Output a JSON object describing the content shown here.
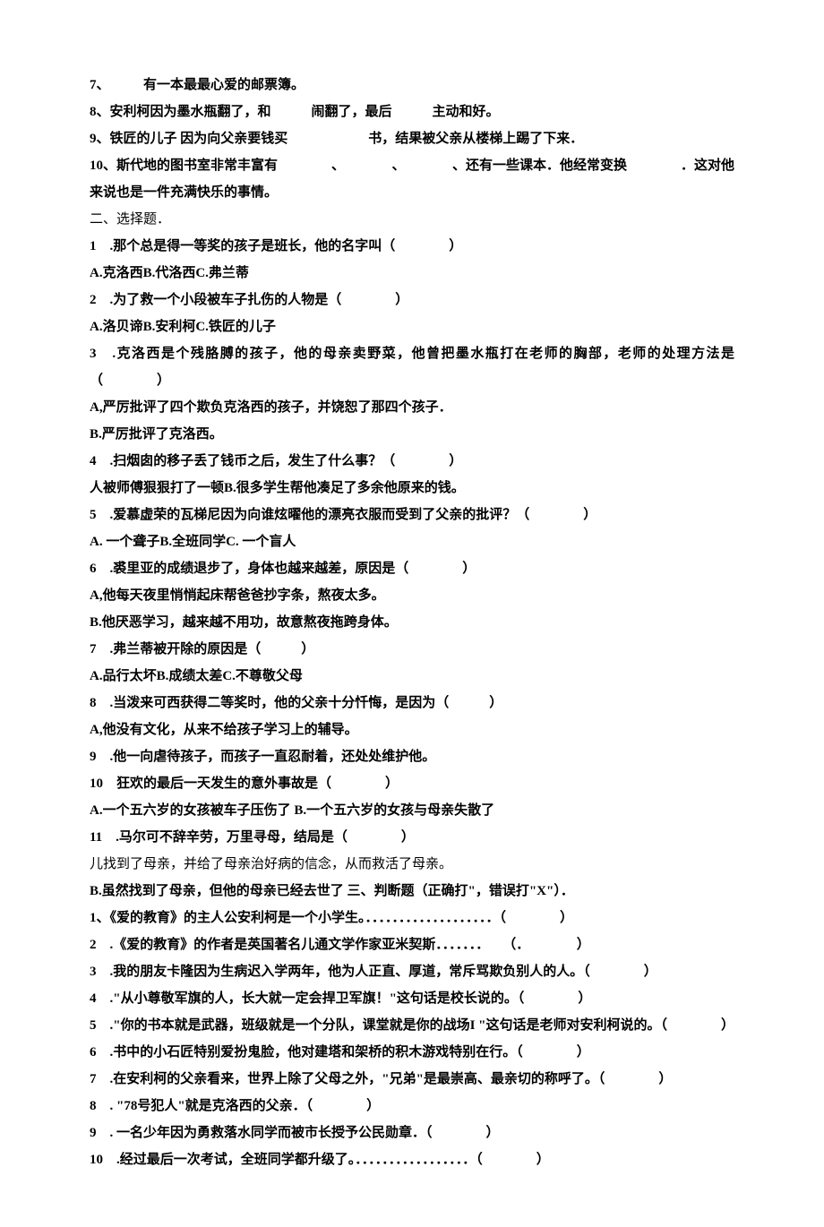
{
  "fill": {
    "q7": "7、　　　有一本最最心爱的邮票簿。",
    "q8": "8、安利柯因为墨水瓶翻了，和　　　闹翻了，最后　　　主动和好。",
    "q9": "9、铁匠的儿子 因为向父亲要钱买　　　　　　书，结果被父亲从楼梯上踢了下来．",
    "q10": "10、斯代地的图书室非常丰富有　　　　、　　　　、　　　　、还有一些课本．他经常变换　　　　．这对他来说也是一件充满快乐的事情。"
  },
  "section2": {
    "title": "二、选择题．",
    "q1": "1　.那个总是得一等奖的孩子是班长，他的名字叫（　　　　）",
    "q1opts": "A.克洛西B.代洛西C.弗兰蒂",
    "q2": "2　.为了救一个小段被车子扎伤的人物是（　　　　）",
    "q2opts": "A.洛贝谛B.安利柯C.铁匠的儿子",
    "q3": "3　.克洛西是个残胳膊的孩子，他的母亲卖野菜，他曾把墨水瓶打在老师的胸部，老师的处理方法是（　　　　）",
    "q3optA": "A,严厉批评了四个欺负克洛西的孩子，并饶恕了那四个孩子．",
    "q3optB": "B.严厉批评了克洛西。",
    "q4": "4　.扫烟囱的移子丢了钱币之后，发生了什么事？（　　　　）",
    "q4opts": "人被师傅狠狠打了一顿B.很多学生帮他凑足了多余他原来的钱。",
    "q5": "5　.爱慕虚荣的瓦梯尼因为向谁炫曜他的漂亮衣服而受到了父亲的批评？（　　　　）",
    "q5opts": "A. 一个聋子B.全班同学C. 一个盲人",
    "q6": "6　.裘里亚的成绩退步了，身体也越来越差，原因是（　　　　）",
    "q6optA": "A,他每天夜里悄悄起床帮爸爸抄字条，熬夜太多。",
    "q6optB": "B.他厌恶学习，越来越不用功，故意熬夜拖跨身体。",
    "q7": "7　.弗兰蒂被开除的原因是（　　　）",
    "q7opts": "A.品行太坏B.成绩太差C.不尊敬父母",
    "q8": "8　.当泼来可西获得二等奖时，他的父亲十分忏悔，是因为（　　　）",
    "q8optA": "A,他没有文化，从来不给孩子学习上的辅导。",
    "q9": "9　.他一向虐待孩子，而孩子一直忍耐着，还处处维护他。",
    "q10": "10　狂欢的最后一天发生的意外事故是（　　　　）",
    "q10opts": "A.一个五六岁的女孩被车子压伤了 B.一个五六岁的女孩与母亲失散了",
    "q11": "11　.马尔可不辞辛劳，万里寻母，结局是（　　　　）",
    "q11optA": "儿找到了母亲，并给了母亲治好病的信念，从而救活了母亲。",
    "q11optB_and_section3": "B.虽然找到了母亲，但他的母亲已经去世了 三、判断题（正确打\"，错误打\"X\"）．"
  },
  "judge": {
    "q1": "1、《爱的教育》的主人公安利柯是一个小学生。．．．．．．．．．．．．．．．．．．．（　　　　）",
    "q2": "2　.《爱的教育》的作者是英国著名儿通文学作家亚米契斯．．．．．．．　　（．　　　　）",
    "q3": "3　.我的朋友卡隆因为生病迟入学两年，他为人正直、厚道，常斥骂欺负别人的人。（　　　　）",
    "q4": "4　.\"从小尊敬军旗的人，长大就一定会捍卫军旗！\"这句话是校长说的。（　　　　）",
    "q5": "5　.\"你的书本就是武器，班级就是一个分队，课堂就是你的战场I \"这句话是老师对安利柯说的。（　　　　）",
    "q6": "6　.书中的小石匠特别爱扮鬼脸，他对建塔和架桥的积木游戏特别在行。（　　　　）",
    "q7": "7　.在安利柯的父亲看来，世界上除了父母之外，\"兄弟\"是最崇高、最亲切的称呼了。（　　　　）",
    "q8": "8　. \"78号犯人\"就是克洛西的父亲．（　　　　）",
    "q9": "9　. 一名少年因为勇救落水同学而被市长授予公民勋章．（　　　　）",
    "q10": "10　.经过最后一次考试，全班同学都升级了。．．．．．．．．．．．．．．．．．（　　　　）"
  }
}
